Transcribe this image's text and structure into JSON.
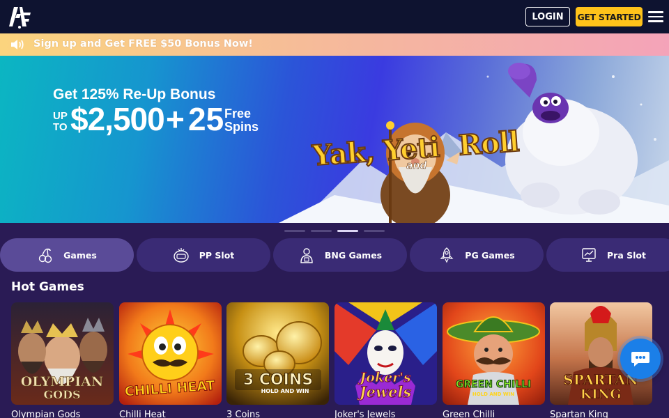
{
  "header": {
    "login_label": "LOGIN",
    "get_started_label": "GET STARTED",
    "logo_text": "ACE"
  },
  "promo_bar": {
    "text": "Sign up and Get FREE $50 Bonus Now!",
    "icon": "speaker-icon"
  },
  "banner": {
    "headline": "Get 125% Re-Up Bonus",
    "up_to": "UP TO",
    "amount": "$2,500",
    "plus": "+",
    "spins_count": "25",
    "spins_text": "Free Spins",
    "game_title": "Yak, Yeti",
    "game_title_connector": "and",
    "game_title_end": "Roll"
  },
  "carousel": {
    "slide_count": 4,
    "active_index": 2
  },
  "categories": [
    {
      "label": "Games",
      "icon": "cherries-icon",
      "active": true
    },
    {
      "label": "PP Slot",
      "icon": "slot-machine-icon",
      "active": false
    },
    {
      "label": "BNG Games",
      "icon": "dealer-icon",
      "active": false
    },
    {
      "label": "PG Games",
      "icon": "rocket-icon",
      "active": false
    },
    {
      "label": "Pra Slot",
      "icon": "chart-screen-icon",
      "active": false
    }
  ],
  "hot_games": {
    "title": "Hot Games",
    "items": [
      {
        "name": "Olympian Gods",
        "art_text": "OLYMPIAN GODS"
      },
      {
        "name": "Chilli Heat",
        "art_text": "CHILLI HEAT"
      },
      {
        "name": "3 Coins",
        "art_text": "3 COINS",
        "art_subtext": "HOLD AND WIN"
      },
      {
        "name": "Joker's Jewels",
        "art_text": "Joker's Jewels"
      },
      {
        "name": "Green Chilli",
        "art_text": "GREEN CHILLI",
        "art_subtext": "HOLD AND WIN"
      },
      {
        "name": "Spartan King",
        "art_text": "SPARTAN KING"
      }
    ]
  },
  "chat": {
    "icon": "chat-bubble-icon"
  },
  "colors": {
    "header_bg": "#0e1330",
    "page_bg": "#2a1b55",
    "accent_yellow": "#ffc31a",
    "category_bg": "#3a2b75",
    "category_active_bg": "#5a4b98",
    "chat_blue": "#1b7fe8"
  }
}
